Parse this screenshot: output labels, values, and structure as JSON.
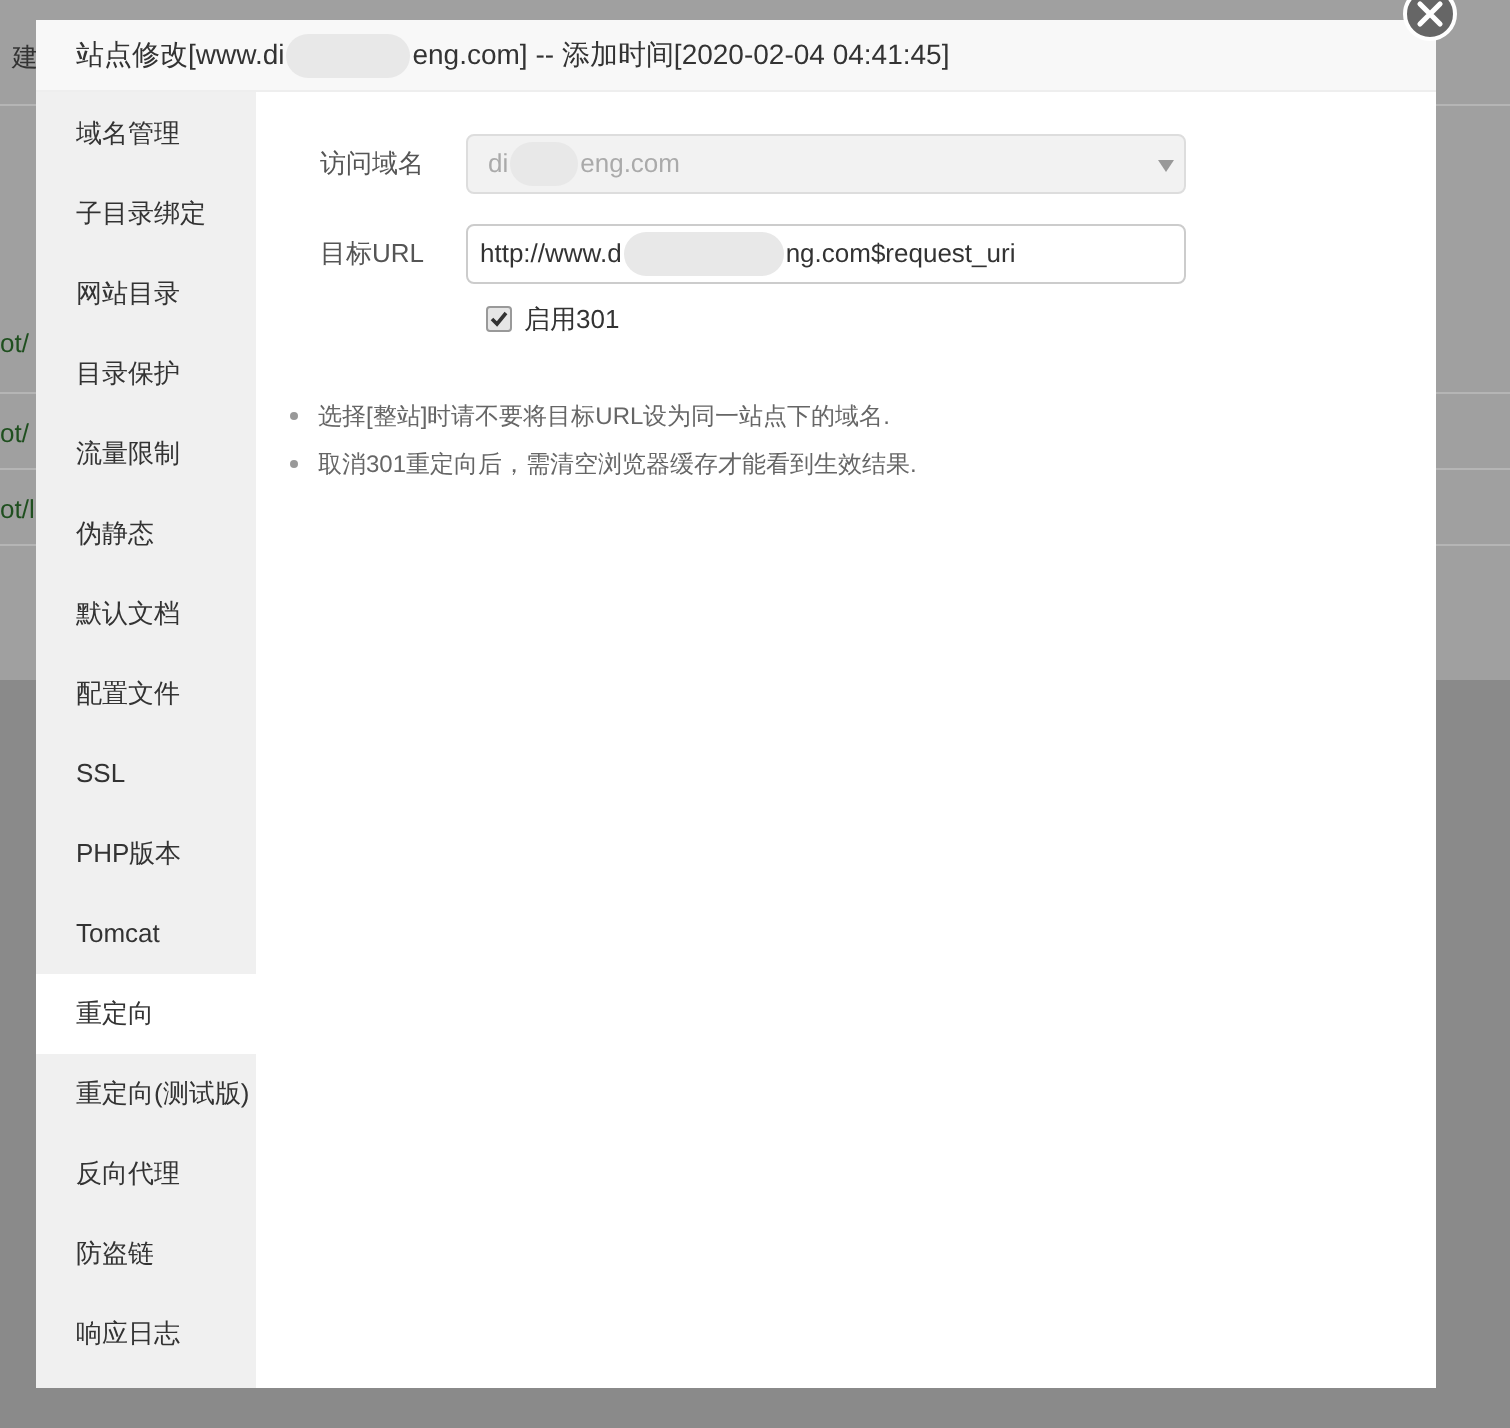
{
  "background": {
    "texts": [
      {
        "text": "建",
        "kind": "plain"
      },
      {
        "text": "ot/",
        "kind": "link"
      },
      {
        "text": "ot/",
        "kind": "link"
      },
      {
        "text": "ot/l",
        "kind": "link"
      }
    ]
  },
  "dialog": {
    "title_parts": [
      "站点修改[www.di",
      "eng.com] -- 添加时间[2020-02-04 04:41:45]"
    ],
    "sidebar": [
      {
        "label": "域名管理",
        "selected": false
      },
      {
        "label": "子目录绑定",
        "selected": false
      },
      {
        "label": "网站目录",
        "selected": false
      },
      {
        "label": "目录保护",
        "selected": false
      },
      {
        "label": "流量限制",
        "selected": false
      },
      {
        "label": "伪静态",
        "selected": false
      },
      {
        "label": "默认文档",
        "selected": false
      },
      {
        "label": "配置文件",
        "selected": false
      },
      {
        "label": "SSL",
        "selected": false
      },
      {
        "label": "PHP版本",
        "selected": false
      },
      {
        "label": "Tomcat",
        "selected": false
      },
      {
        "label": "重定向",
        "selected": true
      },
      {
        "label": "重定向(测试版)",
        "selected": false
      },
      {
        "label": "反向代理",
        "selected": false
      },
      {
        "label": "防盗链",
        "selected": false
      },
      {
        "label": "响应日志",
        "selected": false
      }
    ],
    "form": {
      "domain": {
        "label": "访问域名",
        "value_parts": [
          "di",
          "eng.com"
        ],
        "disabled": true
      },
      "url": {
        "label": "目标URL",
        "value_parts": [
          "http://www.d",
          "ng.com$request_uri"
        ]
      },
      "enable301": {
        "label": "启用301",
        "checked": true
      }
    },
    "notes": [
      "选择[整站]时请不要将目标URL设为同一站点下的域名.",
      "取消301重定向后，需清空浏览器缓存才能看到生效结果."
    ]
  }
}
